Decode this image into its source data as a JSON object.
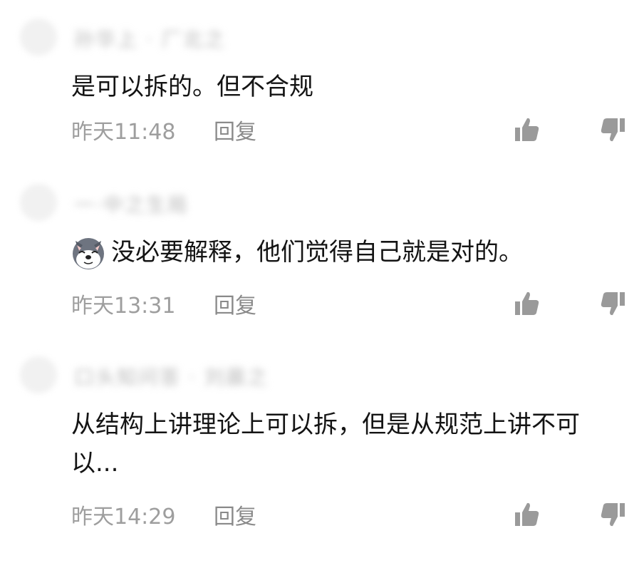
{
  "comments": [
    {
      "username": "孙华上 · 厂北之",
      "text": "是可以拆的。但不合规",
      "time": "昨天11:48",
      "reply_label": "回复"
    },
    {
      "username": "一·中之生局",
      "emoji": "wolf-face-emoji",
      "text": "没必要解释，他们觉得自己就是对的。",
      "time": "昨天13:31",
      "reply_label": "回复"
    },
    {
      "username": "口头知问答 · 刘晨之",
      "text": "从结构上讲理论上可以拆，但是从规范上讲不可以...",
      "time": "昨天14:29",
      "reply_label": "回复"
    }
  ],
  "icons": {
    "like": "thumbs-up-icon",
    "dislike": "thumbs-down-icon"
  },
  "colors": {
    "meta_text": "#9e9e9e",
    "body_text": "#141414",
    "icon": "#9a9a9a"
  }
}
